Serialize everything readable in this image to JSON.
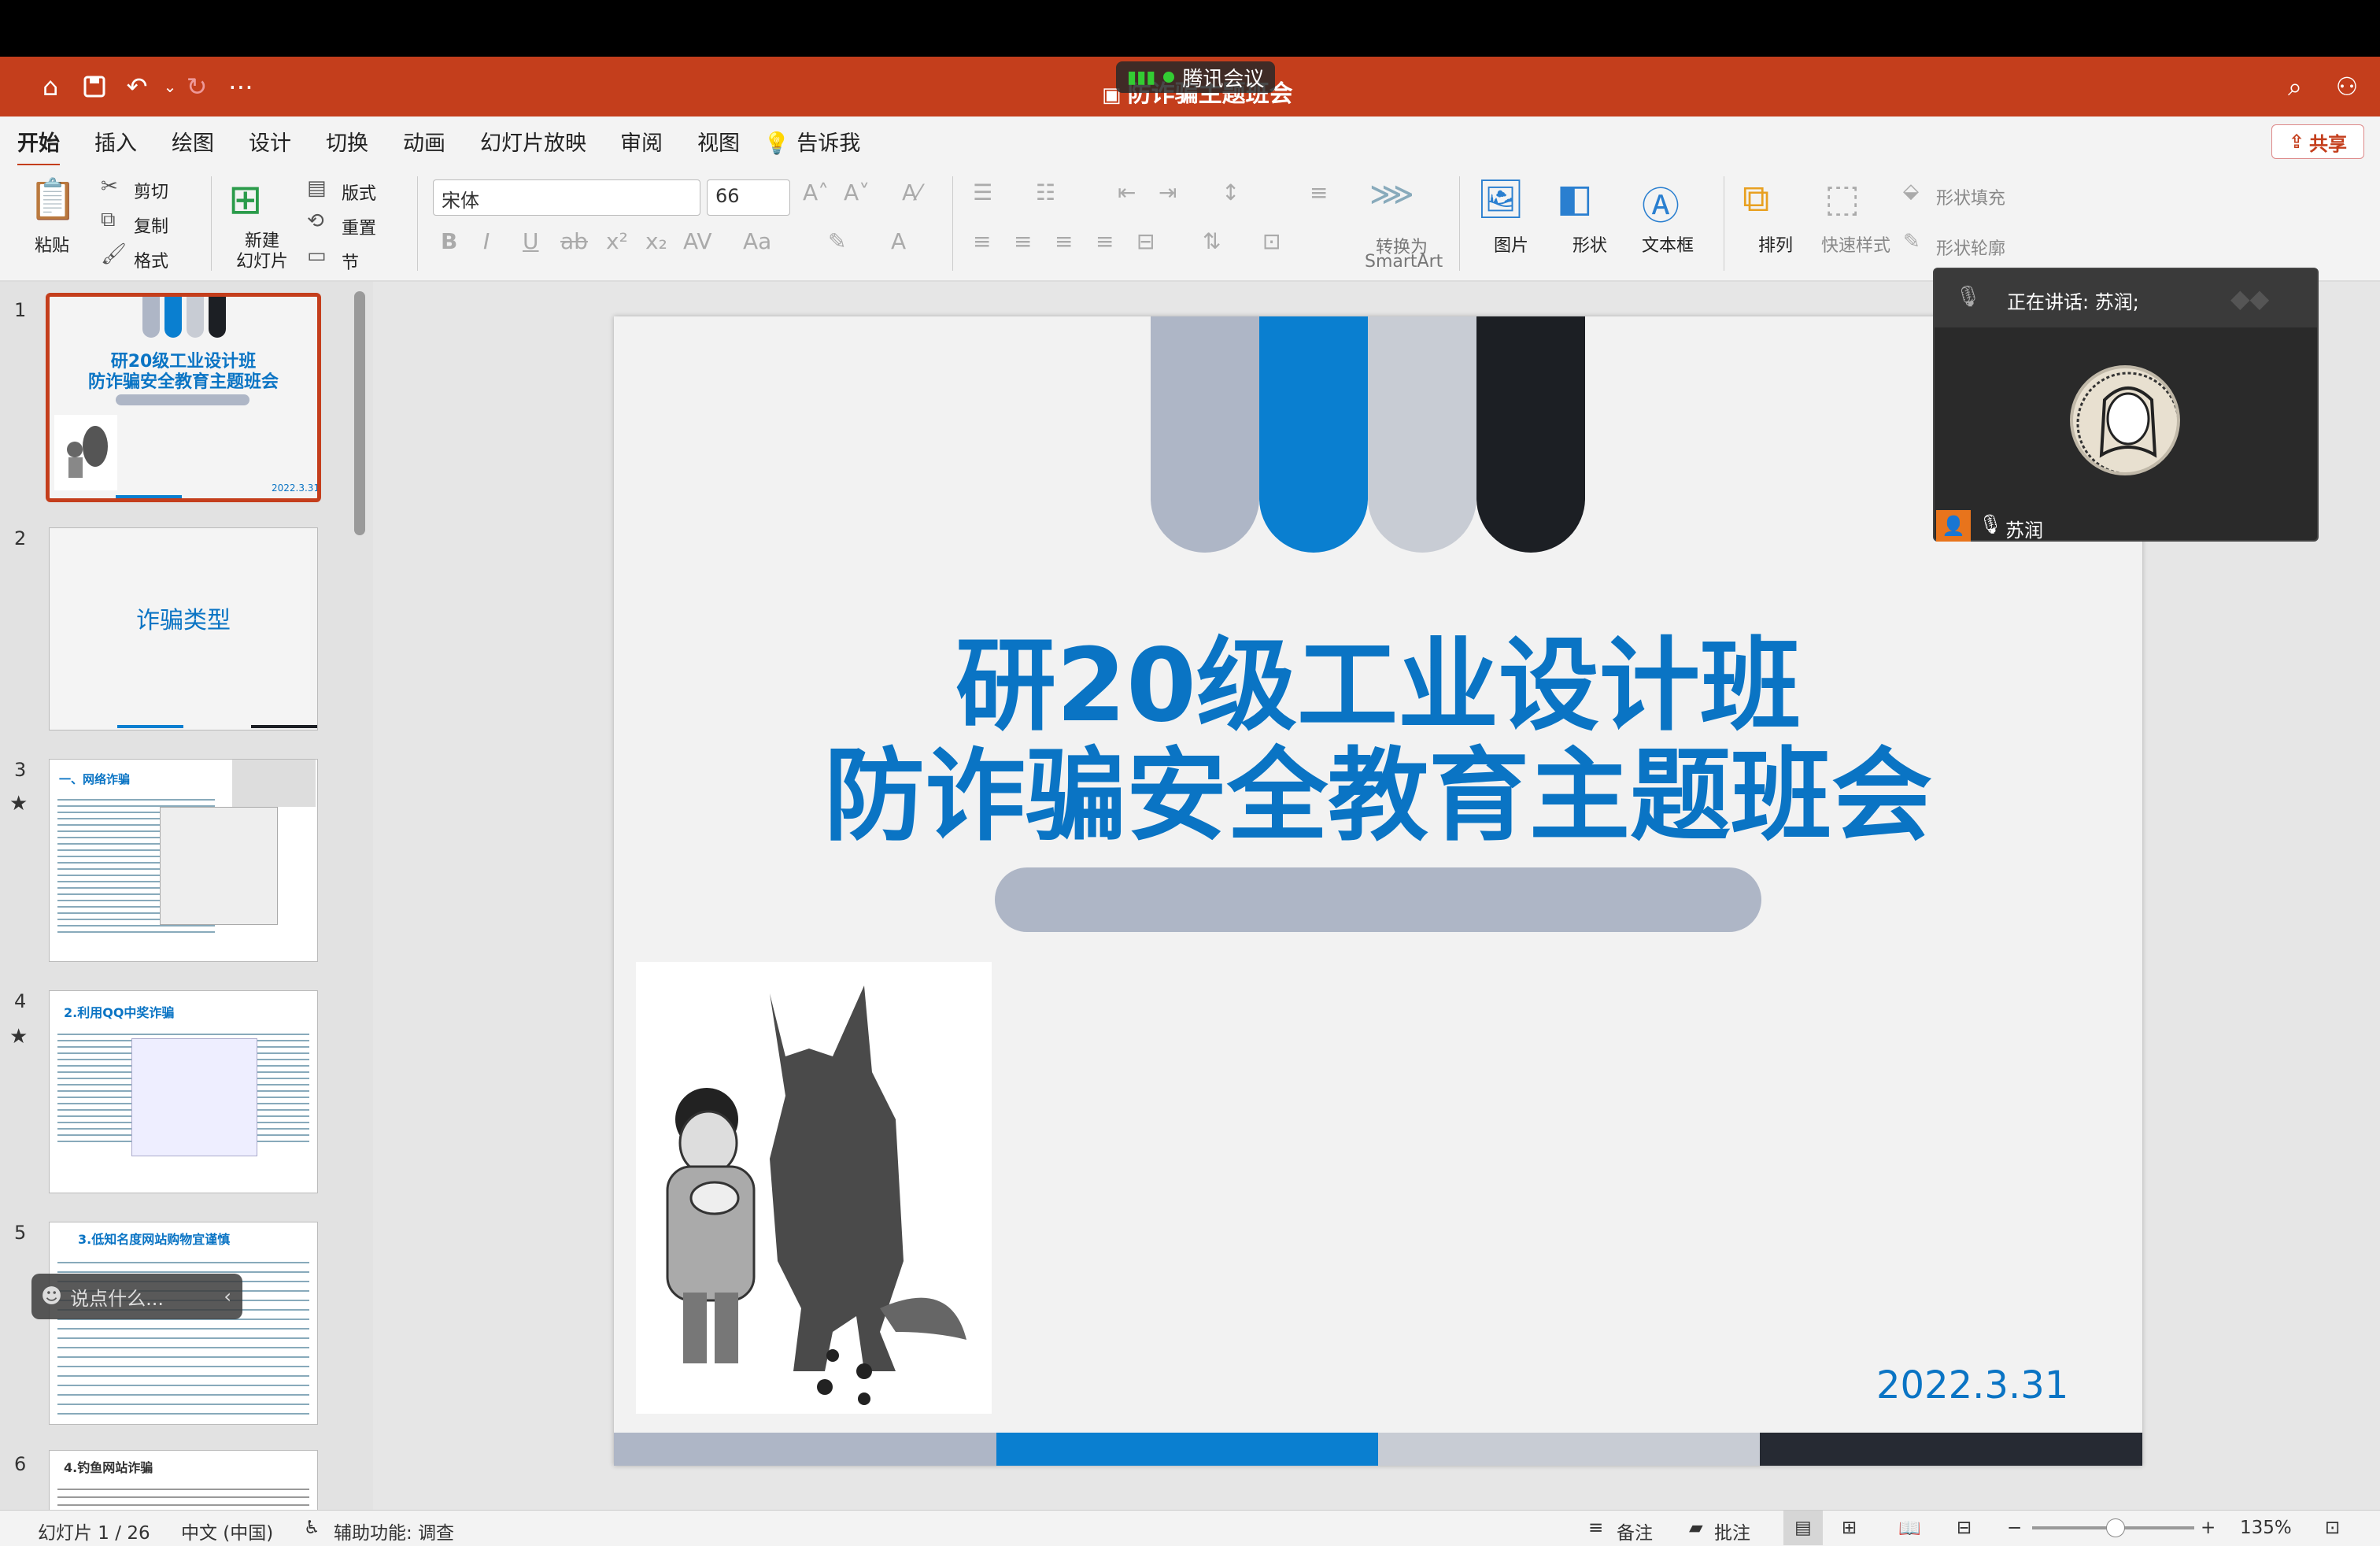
{
  "app": {
    "doc_title": "防诈骗主题班会",
    "meeting_chip": "腾讯会议",
    "share_label": "共享"
  },
  "tabs": [
    "开始",
    "插入",
    "绘图",
    "设计",
    "切换",
    "动画",
    "幻灯片放映",
    "审阅",
    "视图",
    "告诉我"
  ],
  "ribbon": {
    "paste": "粘贴",
    "cut": "剪切",
    "copy": "复制",
    "format": "格式",
    "new_slide": "新建\n幻灯片",
    "layout": "版式",
    "reset": "重置",
    "section": "节",
    "font_name": "宋体",
    "font_size": "66",
    "convert_smartart": "转换为",
    "smartart": "SmartArt",
    "picture": "图片",
    "shape": "形状",
    "textbox": "文本框",
    "arrange": "排列",
    "quick_styles": "快速样式",
    "shape_fill": "形状填充",
    "shape_outline": "形状轮廓"
  },
  "thumbnails": [
    {
      "num": "1",
      "title1": "研20级工业设计班",
      "title2": "防诈骗安全教育主题班会",
      "date": "2022.3.31"
    },
    {
      "num": "2",
      "title": "诈骗类型"
    },
    {
      "num": "3",
      "title": "一、网络诈骗"
    },
    {
      "num": "4",
      "title": "2.利用QQ中奖诈骗"
    },
    {
      "num": "5",
      "title": "3.低知名度网站购物宜谨慎"
    },
    {
      "num": "6",
      "title": "4.钓鱼网站诈骗"
    }
  ],
  "slide": {
    "title_line1": "研20级工业设计班",
    "title_line2": "防诈骗安全教育主题班会",
    "date": "2022.3.31",
    "colors": {
      "grey": "#aeb6c6",
      "blue": "#0a7fd0",
      "light": "#c8ccd4",
      "dark": "#1c1f24"
    }
  },
  "video": {
    "speaking": "正在讲话: 苏润;",
    "participant": "苏润"
  },
  "chat_placeholder": "说点什么...",
  "status": {
    "slide_counter": "幻灯片 1 / 26",
    "language": "中文 (中国)",
    "accessibility": "辅助功能: 调查",
    "notes": "备注",
    "comments": "批注",
    "zoom": "135%"
  }
}
